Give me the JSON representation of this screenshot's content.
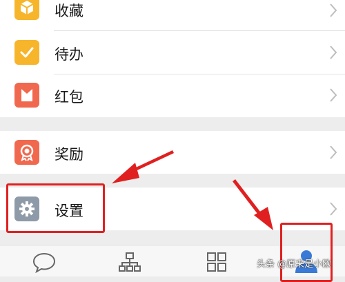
{
  "menu": {
    "group1": [
      {
        "label": "收藏",
        "icon": "cube-icon",
        "color": "#F7B52C"
      },
      {
        "label": "待办",
        "icon": "checkmark-icon",
        "color": "#F7B52C"
      },
      {
        "label": "红包",
        "icon": "red-envelope-icon",
        "color": "#F0694F"
      }
    ],
    "group2": [
      {
        "label": "奖励",
        "icon": "award-badge-icon",
        "color": "#F0694F"
      }
    ],
    "group3": [
      {
        "label": "设置",
        "icon": "gear-icon",
        "color": "#8E9AA8"
      }
    ]
  },
  "tabbar": {
    "tabs": [
      {
        "icon": "chat-bubble-icon"
      },
      {
        "icon": "org-chart-icon"
      },
      {
        "icon": "grid-apps-icon"
      },
      {
        "icon": "person-icon",
        "active": true,
        "active_color": "#3A7AD6"
      }
    ]
  },
  "annotation": {
    "highlight_color": "#E02020"
  },
  "watermark": "头条 @原来是小欧"
}
